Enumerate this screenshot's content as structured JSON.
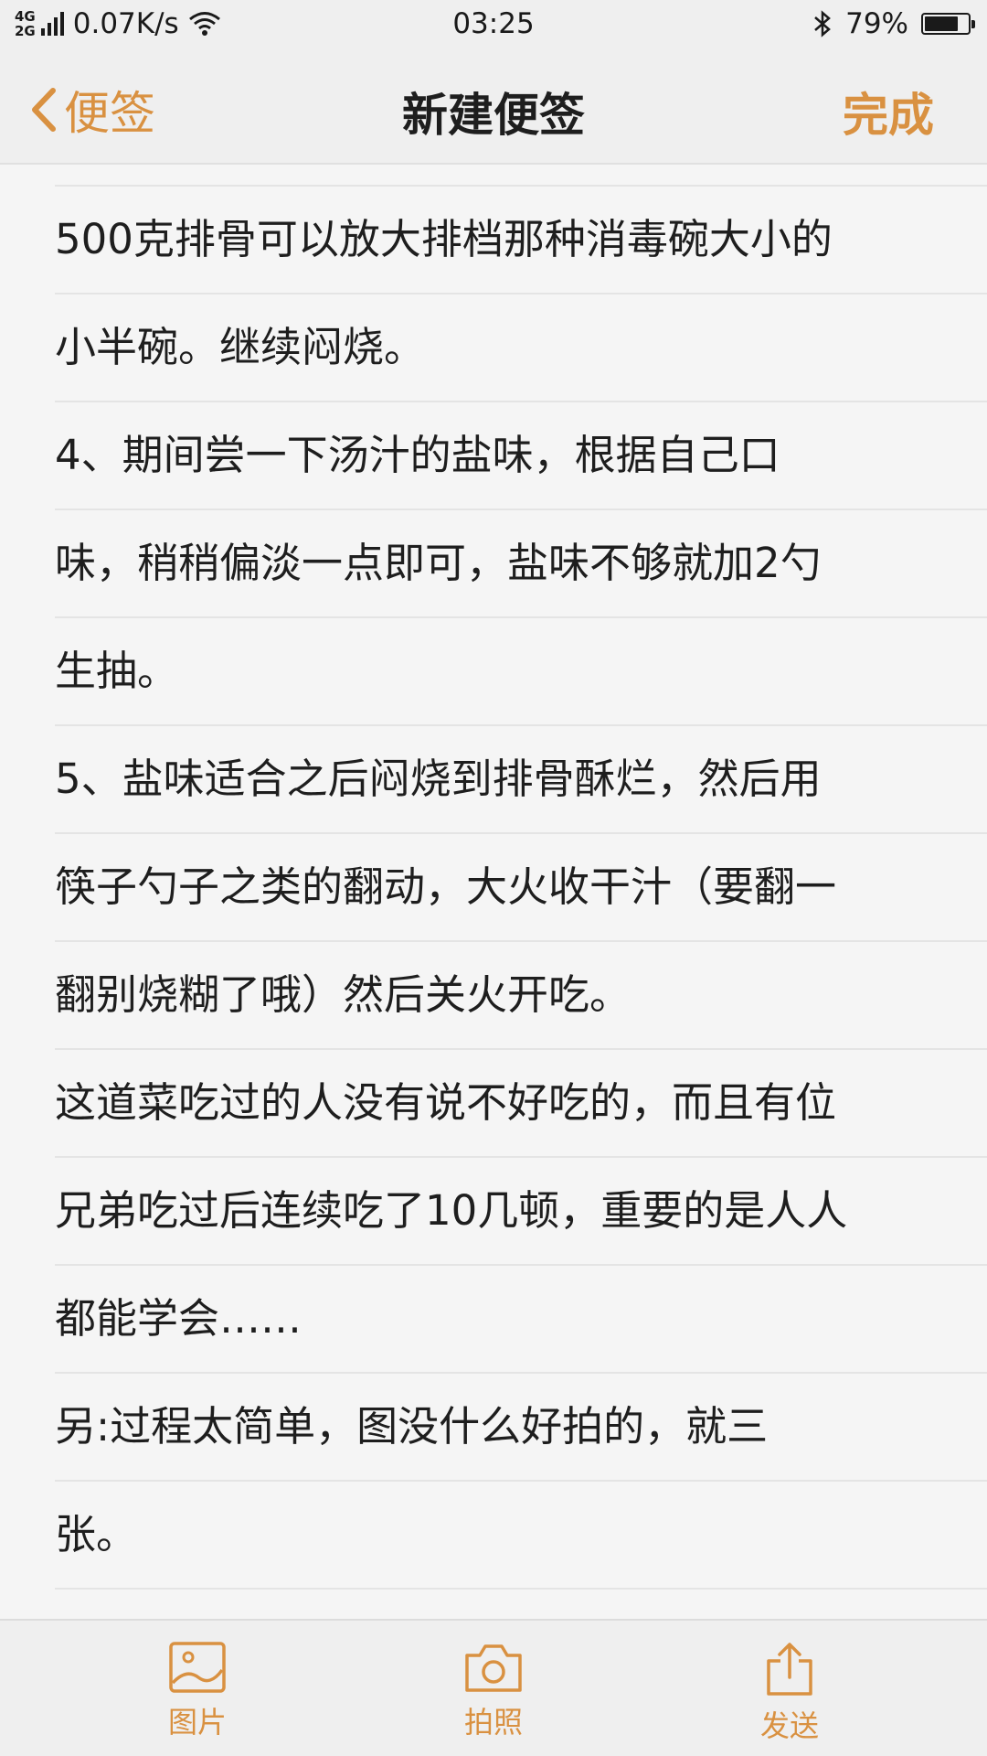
{
  "status_bar": {
    "network_top": "4G",
    "network_bottom": "2G",
    "speed": "0.07K/s",
    "time": "03:25",
    "battery_percent": "79%",
    "battery_level": 0.79,
    "icons": [
      "signal-icon",
      "wifi-icon",
      "bluetooth-icon",
      "battery-icon"
    ]
  },
  "nav": {
    "back_label": "便签",
    "title": "新建便签",
    "done_label": "完成",
    "accent_color": "#d99141"
  },
  "note": {
    "lines": [
      "500克排骨可以放大排档那种消毒碗大小的",
      "小半碗。继续闷烧。",
      "4、期间尝一下汤汁的盐味，根据自己口",
      "味，稍稍偏淡一点即可，盐味不够就加2勺",
      "生抽。",
      "5、盐味适合之后闷烧到排骨酥烂，然后用",
      "筷子勺子之类的翻动，大火收干汁（要翻一",
      "翻别烧糊了哦）然后关火开吃。",
      "这道菜吃过的人没有说不好吃的，而且有位",
      "兄弟吃过后连续吃了10几顿，重要的是人人",
      "都能学会……",
      "另:过程太简单，图没什么好拍的，就三",
      "张。"
    ]
  },
  "toolbar": {
    "image_label": "图片",
    "camera_label": "拍照",
    "send_label": "发送",
    "icons": [
      "image-icon",
      "camera-icon",
      "share-icon"
    ]
  }
}
